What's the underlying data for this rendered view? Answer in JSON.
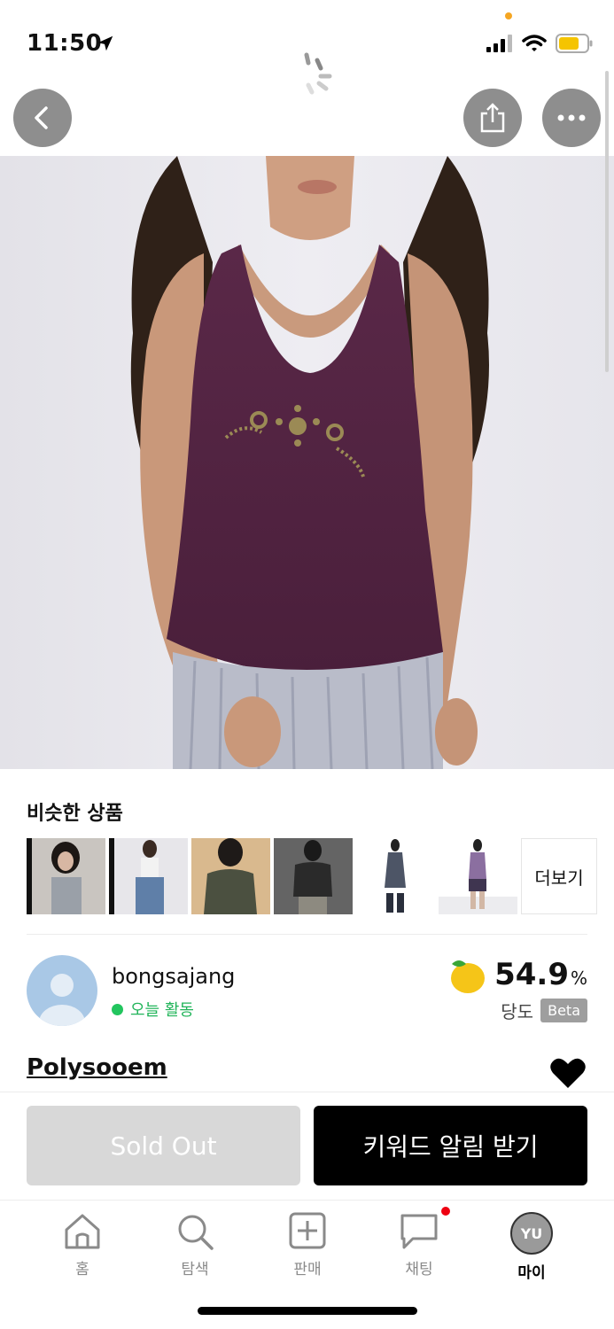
{
  "status_bar": {
    "time": "11:50"
  },
  "similar_section": {
    "title": "비슷한 상품",
    "more_label": "더보기"
  },
  "seller": {
    "name": "bongsajang",
    "activity": "오늘 활동",
    "sweetness_value": "54.9",
    "sweetness_unit": "%",
    "sweetness_label": "당도",
    "beta_label": "Beta"
  },
  "product": {
    "brand": "Polysooem"
  },
  "actions": {
    "sold_out_label": "Sold Out",
    "keyword_alert_label": "키워드 알림 받기"
  },
  "tab_bar": {
    "tabs": [
      {
        "label": "홈",
        "icon": "home-icon"
      },
      {
        "label": "탐색",
        "icon": "search-icon"
      },
      {
        "label": "판매",
        "icon": "plus-square-icon"
      },
      {
        "label": "채팅",
        "icon": "chat-icon"
      },
      {
        "label": "마이",
        "icon": "avatar"
      }
    ],
    "my_initials": "YU"
  },
  "colors": {
    "sold_out_bg": "#d8d8d8",
    "primary_bg": "#000000",
    "online_green": "#22c55e",
    "notification_red": "#ee0011"
  }
}
